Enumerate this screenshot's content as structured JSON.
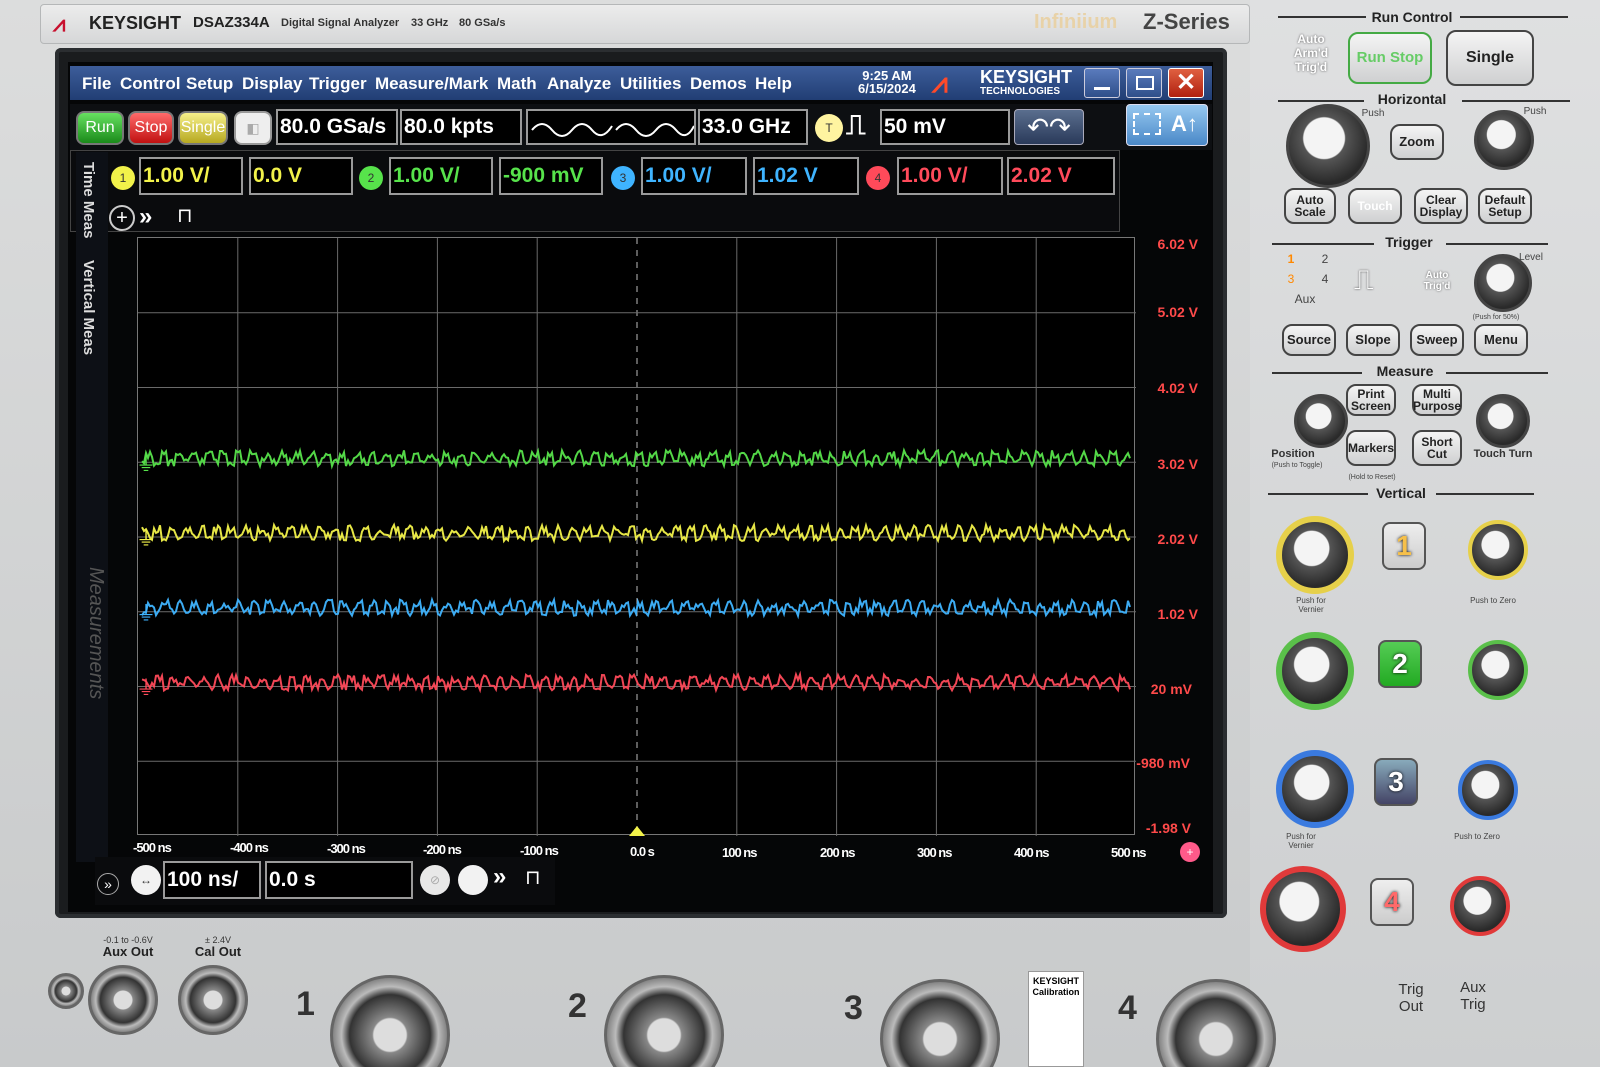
{
  "brand": {
    "logo": "KEYSIGHT",
    "model": "DSAZ334A",
    "desc": "Digital Signal Analyzer",
    "bw": "33 GHz",
    "rate": "80 GSa/s",
    "series_mark": "Infiniium",
    "series": "Z-Series"
  },
  "menu": [
    "File",
    "Control",
    "Setup",
    "Display",
    "Trigger",
    "Measure/Mark",
    "Math",
    "Analyze",
    "Utilities",
    "Demos",
    "Help"
  ],
  "clock": {
    "time": "9:25 AM",
    "date": "6/15/2024"
  },
  "screen_logo": {
    "line1": "KEYSIGHT",
    "line2": "TECHNOLOGIES"
  },
  "toolbar": {
    "run": "Run",
    "stop": "Stop",
    "single": "Single",
    "sample_rate": "80.0 GSa/s",
    "memory": "80.0 kpts",
    "bandwidth": "33.0 GHz",
    "trigger_source": "T",
    "trigger_level": "50 mV"
  },
  "channels": [
    {
      "num": "1",
      "scale": "1.00 V/",
      "offset": "0.0 V",
      "color": "#f2f24a"
    },
    {
      "num": "2",
      "scale": "1.00 V/",
      "offset": "-900 mV",
      "color": "#57e34b"
    },
    {
      "num": "3",
      "scale": "1.00 V/",
      "offset": "1.02 V",
      "color": "#3fb4ff"
    },
    {
      "num": "4",
      "scale": "1.00 V/",
      "offset": "2.02 V",
      "color": "#ff4a5a"
    }
  ],
  "side_tabs": [
    "Time Meas",
    "Vertical Meas"
  ],
  "watermark": "Measurements",
  "y_labels": [
    "6.02 V",
    "5.02 V",
    "4.02 V",
    "3.02 V",
    "2.02 V",
    "1.02 V",
    "20 mV",
    "-980 mV",
    "-1.98 V"
  ],
  "x_labels": [
    "-500 ns",
    "-400 ns",
    "-300 ns",
    "-200 ns",
    "-100 ns",
    "0.0 s",
    "100 ns",
    "200 ns",
    "300 ns",
    "400 ns",
    "500 ns"
  ],
  "timebase": {
    "scale": "100 ns/",
    "delay": "0.0 s"
  },
  "panel": {
    "run_control": "Run Control",
    "auto_armd": "Auto Arm'd Trig'd",
    "run_stop": "Run Stop",
    "single": "Single",
    "horizontal": "Horizontal",
    "zoom": "Zoom",
    "auto_scale": "Auto Scale",
    "touch": "Touch",
    "clear_display": "Clear Display",
    "default_setup": "Default Setup",
    "trigger": "Trigger",
    "trig_inputs": [
      "1",
      "2",
      "3",
      "4"
    ],
    "aux": "Aux",
    "auto_trigd": "Auto Trig'd",
    "push_for_50": "(Push for 50%)",
    "source": "Source",
    "slope": "Slope",
    "sweep": "Sweep",
    "menu": "Menu",
    "measure": "Measure",
    "print_screen": "Print Screen",
    "multi_purpose": "Multi Purpose",
    "markers": "Markers",
    "short_cut": "Short Cut",
    "position": "Position",
    "push_to_toggle": "(Push to Toggle)",
    "hold_to_reset": "(Hold to Reset)",
    "touch_turn": "Touch Turn",
    "vertical": "Vertical",
    "push_vernier": "Push for Vernier",
    "push_zero": "Push to Zero",
    "level": "Level",
    "push": "Push"
  },
  "lower": {
    "aux_out": "Aux Out",
    "aux_out_range": "-0.1 to -0.6V",
    "cal_out": "Cal Out",
    "cal_out_range": "± 2.4V",
    "trig_out": "Trig Out",
    "aux_trig": "Aux Trig",
    "cal_label": "KEYSIGHT Calibration"
  }
}
